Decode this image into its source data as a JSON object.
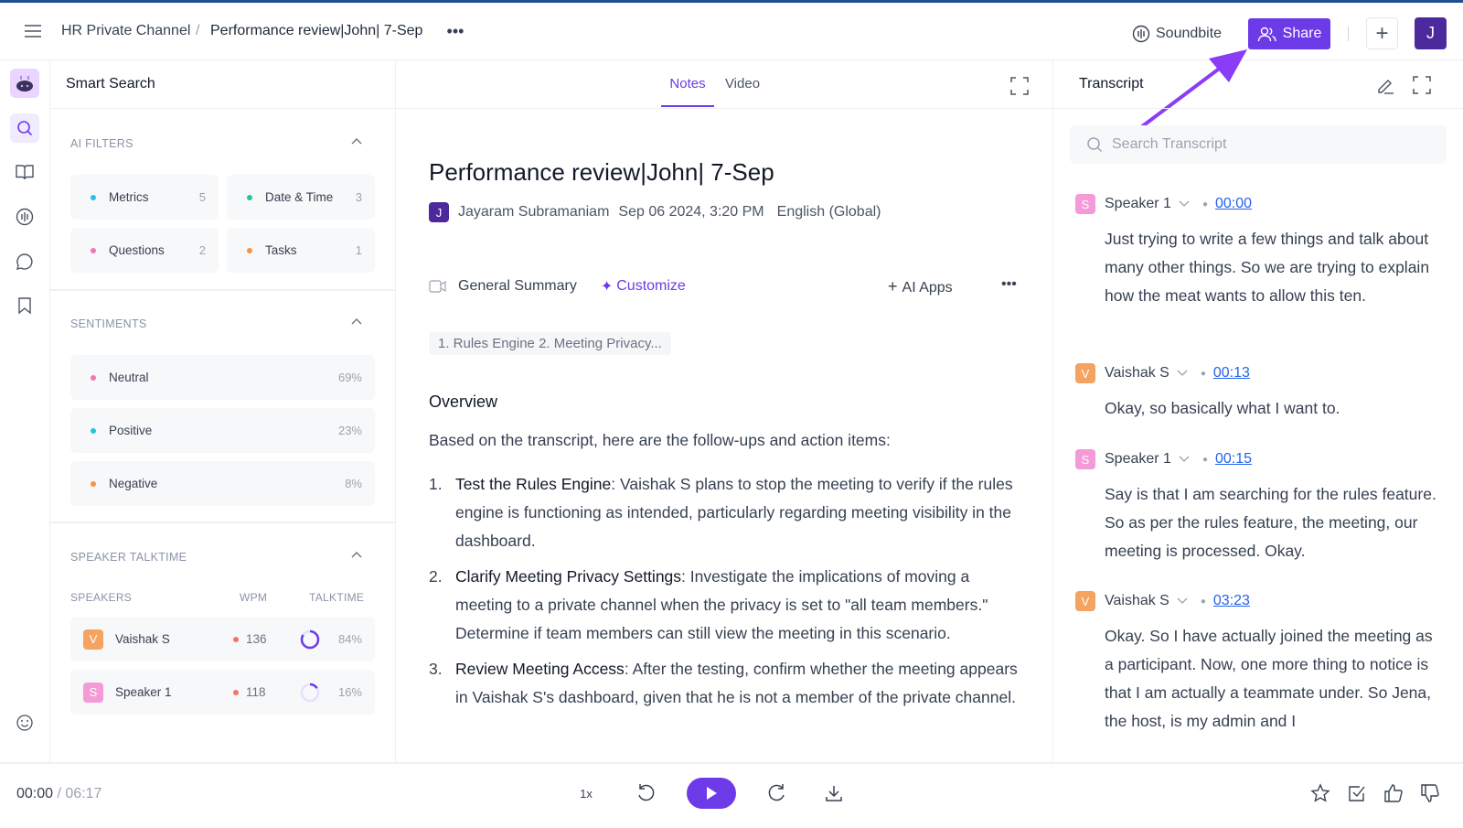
{
  "header": {
    "breadcrumb_channel": "HR Private Channel",
    "breadcrumb_sep": "/",
    "breadcrumb_meeting": "Performance review|John| 7-Sep",
    "soundbite": "Soundbite",
    "share": "Share",
    "avatar": "J"
  },
  "left": {
    "title": "Smart Search",
    "ai_filters": {
      "title": "AI FILTERS",
      "items": [
        {
          "label": "Metrics",
          "count": "5",
          "color": "#22c3e6"
        },
        {
          "label": "Date & Time",
          "count": "3",
          "color": "#22c3a6"
        },
        {
          "label": "Questions",
          "count": "2",
          "color": "#f472b6"
        },
        {
          "label": "Tasks",
          "count": "1",
          "color": "#fb923c"
        }
      ]
    },
    "sentiments": {
      "title": "SENTIMENTS",
      "items": [
        {
          "label": "Neutral",
          "value": "69%",
          "color": "#f472b6"
        },
        {
          "label": "Positive",
          "value": "23%",
          "color": "#22c3e6"
        },
        {
          "label": "Negative",
          "value": "8%",
          "color": "#fb923c"
        }
      ]
    },
    "talktime": {
      "title": "SPEAKER TALKTIME",
      "col_speakers": "SPEAKERS",
      "col_wpm": "WPM",
      "col_talktime": "TALKTIME",
      "rows": [
        {
          "initial": "V",
          "name": "Vaishak S",
          "wpm": "136",
          "talktime": "84%",
          "fraction": 0.84,
          "color": "#f4a460"
        },
        {
          "initial": "S",
          "name": "Speaker 1",
          "wpm": "118",
          "talktime": "16%",
          "fraction": 0.16,
          "color": "#f49ad6"
        }
      ]
    }
  },
  "center": {
    "tabs": [
      "Notes",
      "Video"
    ],
    "title": "Performance review|John| 7-Sep",
    "meta": {
      "avatar": "J",
      "owner": "Jayaram Subramaniam",
      "date": "Sep 06 2024, 3:20 PM",
      "language": "English (Global)"
    },
    "summary_type": "General Summary",
    "customize": "Customize",
    "ai_apps": "AI Apps",
    "topics_chip": "1. Rules Engine 2. Meeting Privacy...",
    "overview_heading": "Overview",
    "intro": "Based on the transcript, here are the follow-ups and action items:",
    "items": [
      {
        "num": "1.",
        "bold": "Test the Rules Engine",
        "text": ": Vaishak S plans to stop the meeting to verify if the rules engine is functioning as intended, particularly regarding meeting visibility in the dashboard."
      },
      {
        "num": "2.",
        "bold": "Clarify Meeting Privacy Settings",
        "text": ": Investigate the implications of moving a meeting to a private channel when the privacy is set to \"all team members.\" Determine if team members can still view the meeting in this scenario."
      },
      {
        "num": "3.",
        "bold": "Review Meeting Access",
        "text": ": After the testing, confirm whether the meeting appears in Vaishak S's dashboard, given that he is not a member of the private channel."
      }
    ]
  },
  "transcript": {
    "title": "Transcript",
    "search_placeholder": "Search Transcript",
    "entries": [
      {
        "initial": "S",
        "speaker": "Speaker 1",
        "time": "00:00",
        "color": "#f49ad6",
        "text": "Just trying to write a few things and talk about many other things. So we are trying to explain how the meat wants to allow this ten."
      },
      {
        "initial": "V",
        "speaker": "Vaishak S",
        "time": "00:13",
        "color": "#f4a460",
        "text": "Okay, so basically what I want to."
      },
      {
        "initial": "S",
        "speaker": "Speaker 1",
        "time": "00:15",
        "color": "#f49ad6",
        "text": "Say is that I am searching for the rules feature. So as per the rules feature, the meeting, our meeting is processed. Okay."
      },
      {
        "initial": "V",
        "speaker": "Vaishak S",
        "time": "03:23",
        "color": "#f4a460",
        "text": "Okay. So I have actually joined the meeting as a participant. Now, one more thing to notice is that I am actually a teammate under. So Jena, the host, is my admin and I"
      }
    ]
  },
  "player": {
    "current": "00:00",
    "sep": "/",
    "duration": "06:17",
    "speed": "1x",
    "progress": 0
  },
  "colors": {
    "accent": "#6d3ae8",
    "link": "#2563eb"
  }
}
